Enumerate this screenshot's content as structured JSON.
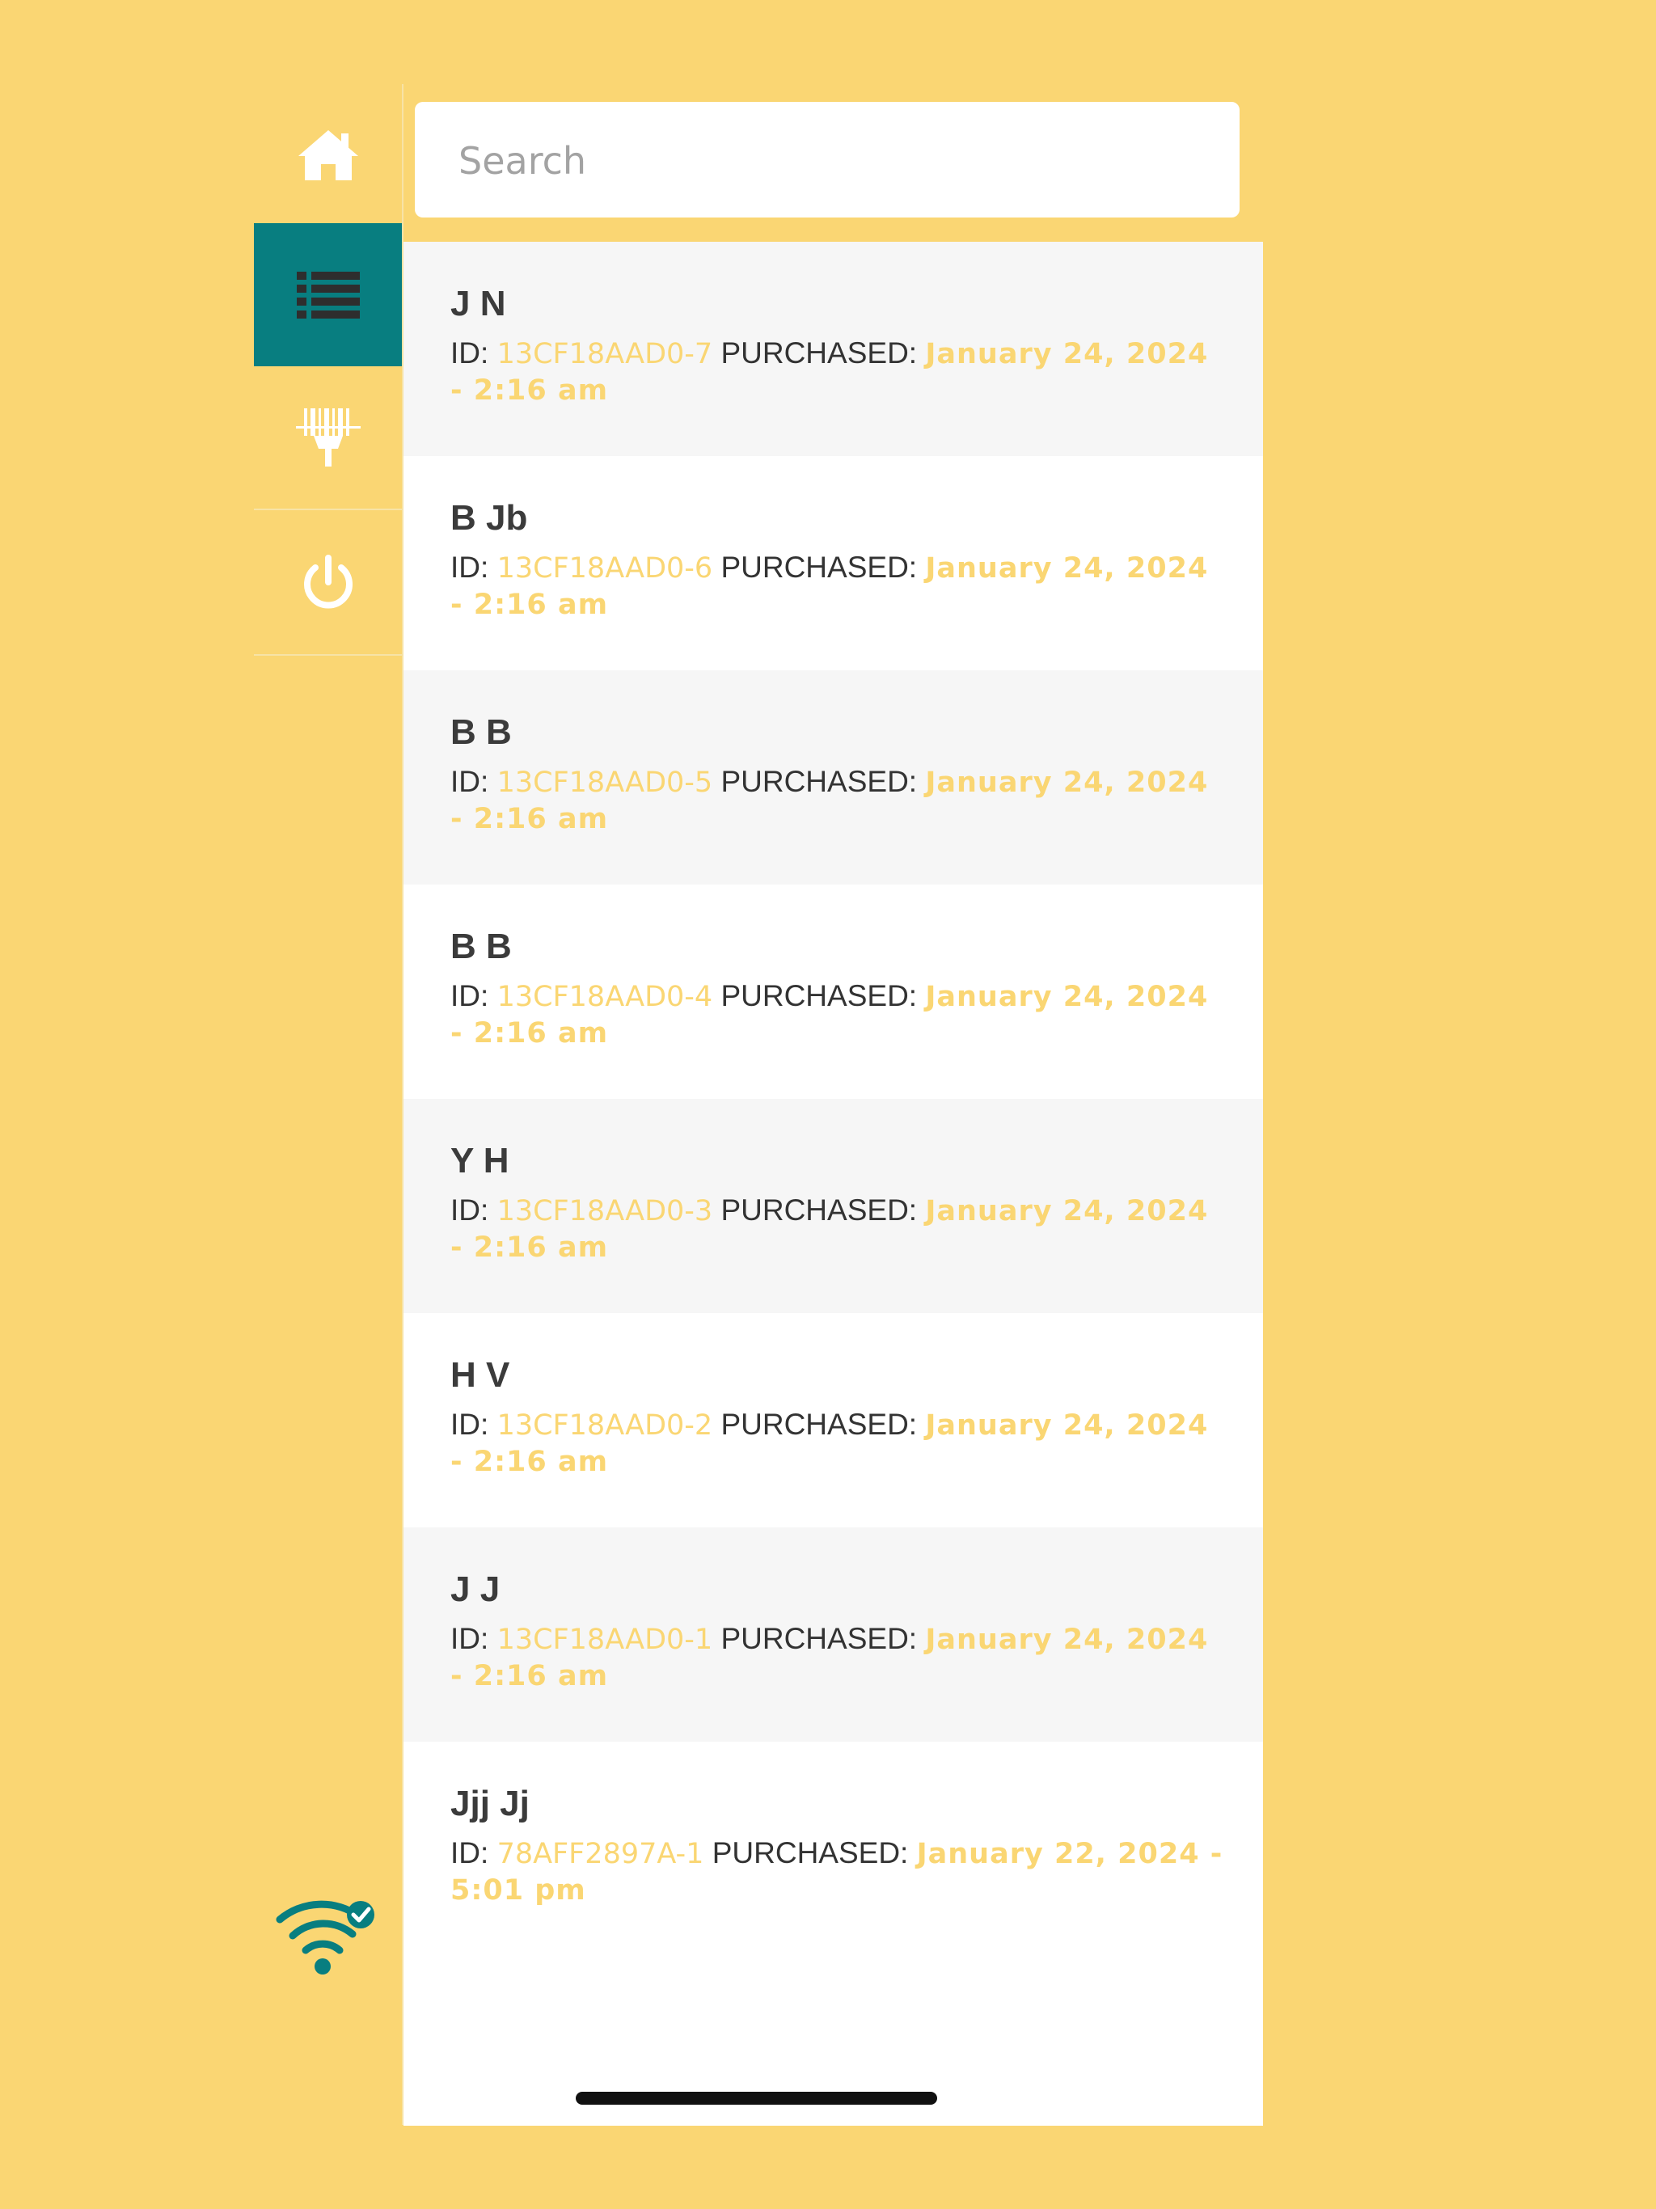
{
  "colors": {
    "background": "#FAD673",
    "accent": "#087E80",
    "text": "#333333",
    "highlight": "#FAD673"
  },
  "sidebar": {
    "items": [
      {
        "icon": "home-icon",
        "active": false
      },
      {
        "icon": "list-icon",
        "active": true
      },
      {
        "icon": "barcode-scanner-icon",
        "active": false
      },
      {
        "icon": "power-icon",
        "active": false
      }
    ],
    "status_icon": "wifi-connected-icon"
  },
  "search": {
    "placeholder": "Search",
    "value": ""
  },
  "labels": {
    "id": "ID:",
    "purchased": "PURCHASED:"
  },
  "purchases": [
    {
      "name": "J N",
      "id": "13CF18AAD0-7",
      "date": "January 24, 2024 - 2:16 am"
    },
    {
      "name": "B Jb",
      "id": "13CF18AAD0-6",
      "date": "January 24, 2024 - 2:16 am"
    },
    {
      "name": "B B",
      "id": "13CF18AAD0-5",
      "date": "January 24, 2024 - 2:16 am"
    },
    {
      "name": "B B",
      "id": "13CF18AAD0-4",
      "date": "January 24, 2024 - 2:16 am"
    },
    {
      "name": "Y H",
      "id": "13CF18AAD0-3",
      "date": "January 24, 2024 - 2:16 am"
    },
    {
      "name": "H V",
      "id": "13CF18AAD0-2",
      "date": "January 24, 2024 - 2:16 am"
    },
    {
      "name": "J J",
      "id": "13CF18AAD0-1",
      "date": "January 24, 2024 - 2:16 am"
    },
    {
      "name": "Jjj Jj",
      "id": "78AFF2897A-1",
      "date": "January 22, 2024 - 5:01 pm"
    }
  ]
}
